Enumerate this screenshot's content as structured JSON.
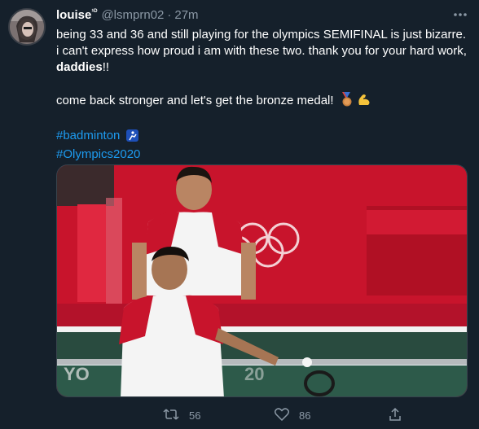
{
  "tweet": {
    "display_name": "louise",
    "display_name_superscript": "¹ᴰ",
    "handle": "@lsmprn02",
    "separator": "·",
    "time": "27m",
    "text_line1": "being 33 and 36 and still playing for the olympics SEMIFINAL is just bizarre. i can't express how proud i am with these two. thank you for your hard work, ",
    "text_bold": "daddies",
    "text_line1_end": "!!",
    "text_para2": "come back stronger and let's get the bronze medal!",
    "hashtags": [
      "#badminton",
      "#Olympics2020"
    ],
    "retweet_count": "56",
    "like_count": "86"
  },
  "colors": {
    "background": "#15202b",
    "text": "#ffffff",
    "muted": "#8b98a5",
    "link": "#1d9bf0",
    "court_red": "#c8142c",
    "court_green": "#2d5a4a"
  },
  "icons": [
    "more-icon",
    "badminton-icon",
    "bronze-medal-icon",
    "flexed-biceps-icon",
    "retweet-icon",
    "like-icon",
    "share-icon"
  ]
}
